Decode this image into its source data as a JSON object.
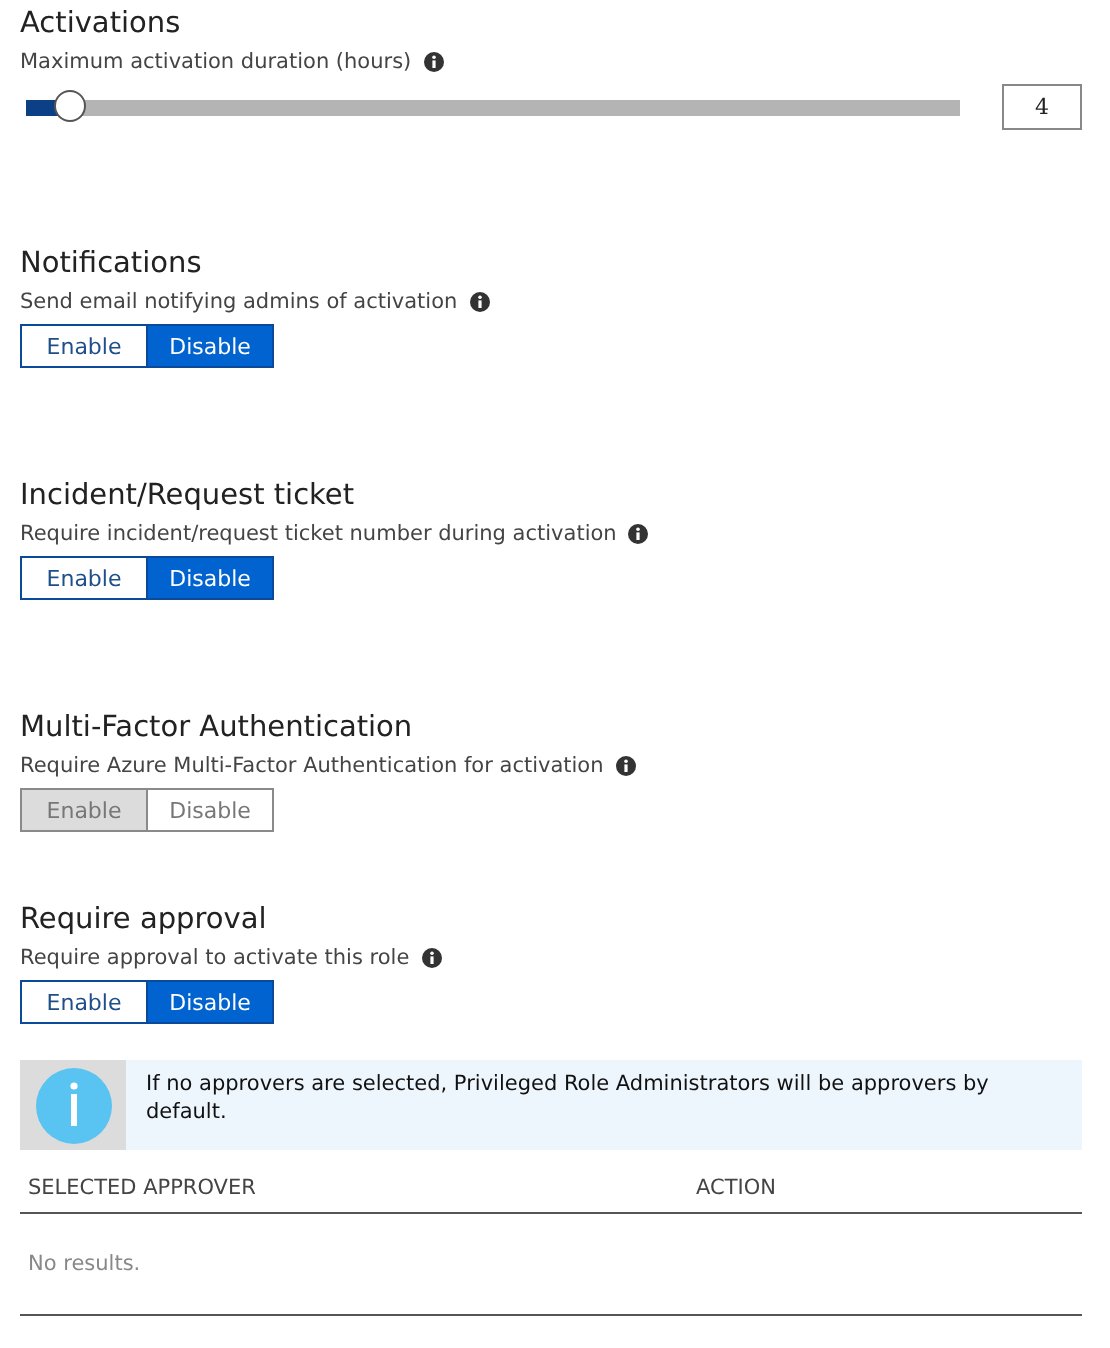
{
  "sections": [
    {
      "kind": "slider",
      "title": "Activations",
      "label": "Maximum activation duration (hours)",
      "level": 0.05,
      "value": "4"
    },
    {
      "kind": "toggle",
      "title": "Notifications",
      "label": "Send email notifying admins of activation",
      "disabled": false,
      "options": [
        {
          "label": "Enable",
          "selected": false
        },
        {
          "label": "Disable",
          "selected": true
        }
      ]
    },
    {
      "kind": "toggle",
      "title": "Incident/Request ticket",
      "label": "Require incident/request ticket number during activation",
      "disabled": false,
      "options": [
        {
          "label": "Enable",
          "selected": false
        },
        {
          "label": "Disable",
          "selected": true
        }
      ]
    },
    {
      "kind": "toggle",
      "title": "Multi-Factor Authentication",
      "label": "Require Azure Multi-Factor Authentication for activation",
      "disabled": true,
      "options": [
        {
          "label": "Enable",
          "selected": true
        },
        {
          "label": "Disable",
          "selected": false
        }
      ]
    },
    {
      "kind": "toggle",
      "title": "Require approval",
      "label": "Require approval to activate this role",
      "disabled": false,
      "options": [
        {
          "label": "Enable",
          "selected": false
        },
        {
          "label": "Disable",
          "selected": true
        }
      ]
    }
  ],
  "info_banner": {
    "text": "If no approvers are selected, Privileged Role Administrators will be approvers by default."
  },
  "table": {
    "columns": [
      "SELECTED APPROVER",
      "ACTION"
    ],
    "empty_text": "No results."
  }
}
